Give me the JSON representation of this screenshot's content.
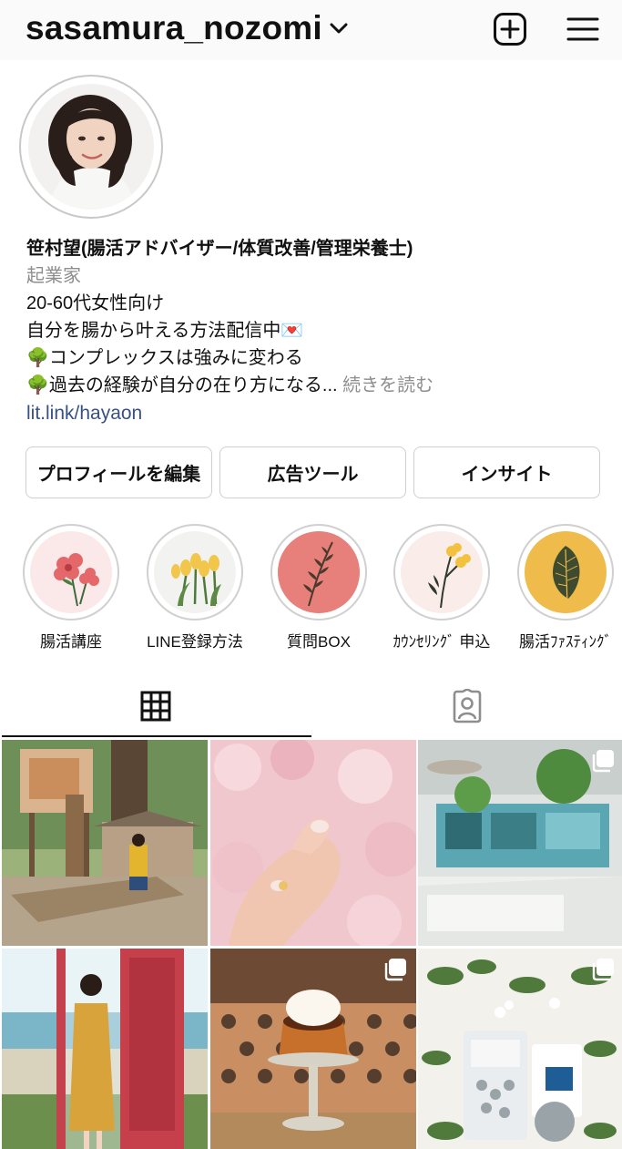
{
  "header": {
    "username": "sasamura_nozomi",
    "new_post_icon": "plus-square-icon",
    "menu_icon": "hamburger-menu-icon"
  },
  "profile": {
    "name": "笹村望(腸活アドバイザー/体質改善/管理栄養士)",
    "category": "起業家",
    "bio_lines": [
      "20-60代女性向け",
      "自分を腸から叶える方法配信中💌",
      "🌳コンプレックスは強みに変わる",
      "🌳過去の経験が自分の在り方になる..."
    ],
    "more_label": "続きを読む",
    "link": "lit.link/hayaon"
  },
  "buttons": {
    "edit_profile": "プロフィールを編集",
    "ad_tools": "広告ツール",
    "insights": "インサイト"
  },
  "highlights": [
    {
      "label": "腸活講座"
    },
    {
      "label": "LINE登録方法"
    },
    {
      "label": "質問BOX"
    },
    {
      "label": "ｶｳﾝｾﾘﾝｸﾞ 申込"
    },
    {
      "label": "腸活ﾌｧｽﾃｨﾝｸﾞ"
    }
  ],
  "tabs": {
    "grid_icon": "grid-icon",
    "tagged_icon": "tagged-person-icon"
  },
  "colors": {
    "link": "#385185",
    "muted": "#8e8e8e",
    "highlight_red": "#e77f7a",
    "highlight_yellow": "#efbb4a"
  }
}
